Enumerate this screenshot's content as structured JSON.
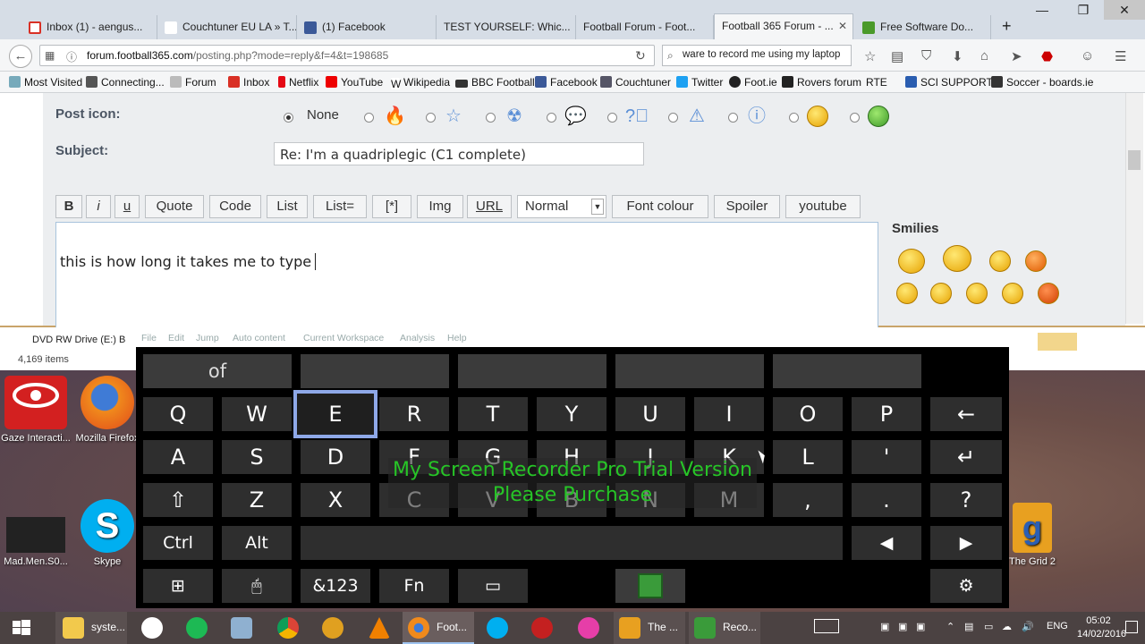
{
  "browser": {
    "tabs": [
      {
        "label": "Inbox (1) - aengus...",
        "icon": "gmail-icon",
        "color": "#d93025"
      },
      {
        "label": "Couchtuner EU LA » T...",
        "icon": "page-icon",
        "color": "#888888"
      },
      {
        "label": "(1) Facebook",
        "icon": "facebook-icon",
        "color": "#3b5998"
      },
      {
        "label": "TEST YOURSELF: Whic...",
        "icon": "page-icon",
        "color": "#888888"
      },
      {
        "label": "Football Forum - Foot...",
        "icon": "page-icon",
        "color": "#888888"
      },
      {
        "label": "Football 365 Forum - ...",
        "icon": "page-icon",
        "color": "#888888",
        "active": true
      },
      {
        "label": "Free Software Do...",
        "icon": "download-icon",
        "color": "#4a9a2a"
      }
    ],
    "url_host": "forum.football365.com",
    "url_path": "/posting.php?mode=reply&f=4&t=198685",
    "search_value": "ware to record me using my laptop",
    "bookmarks": [
      "Most Visited",
      "Connecting...",
      "Forum",
      "Inbox",
      "Netflix",
      "YouTube",
      "Wikipedia",
      "BBC Football",
      "Facebook",
      "Couchtuner",
      "Twitter",
      "Foot.ie",
      "Rovers forum",
      "RTE",
      "SCI",
      "SUPPORT",
      "Soccer - boards.ie"
    ]
  },
  "form": {
    "post_icon_label": "Post icon:",
    "none_label": "None",
    "subject_label": "Subject:",
    "subject_value": "Re: I'm a quadriplegic (C1 complete)",
    "toolbar": [
      "B",
      "i",
      "u",
      "Quote",
      "Code",
      "List",
      "List=",
      "[*]",
      "Img",
      "URL",
      "Normal",
      "Font colour",
      "Spoiler",
      "youtube"
    ],
    "editor_text": "this is how long it takes me to type",
    "smilies_label": "Smilies"
  },
  "explorer": {
    "dvd_label": "DVD RW Drive (E:) B",
    "items_count": "4,169 items",
    "menu": [
      "File",
      "Edit",
      "Jump",
      "Auto content",
      "Current Workspace",
      "Analysis",
      "Help"
    ]
  },
  "keyboard": {
    "suggestions": [
      "of",
      "",
      "",
      "",
      ""
    ],
    "row1": [
      "Q",
      "W",
      "E",
      "R",
      "T",
      "Y",
      "U",
      "I",
      "O",
      "P",
      "←"
    ],
    "row2": [
      "A",
      "S",
      "D",
      "F",
      "G",
      "H",
      "J",
      "K",
      "L",
      "'",
      "↵"
    ],
    "row3": [
      "⇧",
      "Z",
      "X",
      "C",
      "V",
      "B",
      "N",
      "M",
      ",",
      ".",
      "?"
    ],
    "row4": [
      "Ctrl",
      "Alt",
      "",
      "◀",
      "▶"
    ],
    "row5": [
      "⊞",
      "🖱",
      "&123",
      "Fn",
      "▭",
      "",
      "⚙"
    ],
    "selected_key": "E"
  },
  "watermark": {
    "line1": "My Screen Recorder Pro Trial Version",
    "line2": "Please Purchase"
  },
  "desktop_icons": [
    {
      "label": "Gaze Interacti...",
      "icon": "gaze-icon"
    },
    {
      "label": "Mozilla Firefox",
      "icon": "firefox-icon"
    },
    {
      "label": "Mad.Men.S0...",
      "icon": "video-file-icon"
    },
    {
      "label": "Skype",
      "icon": "skype-icon"
    },
    {
      "label": "The Grid 2",
      "icon": "grid2-icon"
    }
  ],
  "taskbar": {
    "items": [
      {
        "label": "syste...",
        "icon": "folder-icon"
      },
      {
        "label": "Foot...",
        "icon": "firefox-icon",
        "active": true
      },
      {
        "label": "The ...",
        "icon": "grid2-icon"
      },
      {
        "label": "Reco...",
        "icon": "recorder-icon"
      }
    ],
    "language": "ENG",
    "time": "05:02",
    "date": "14/02/2016"
  }
}
